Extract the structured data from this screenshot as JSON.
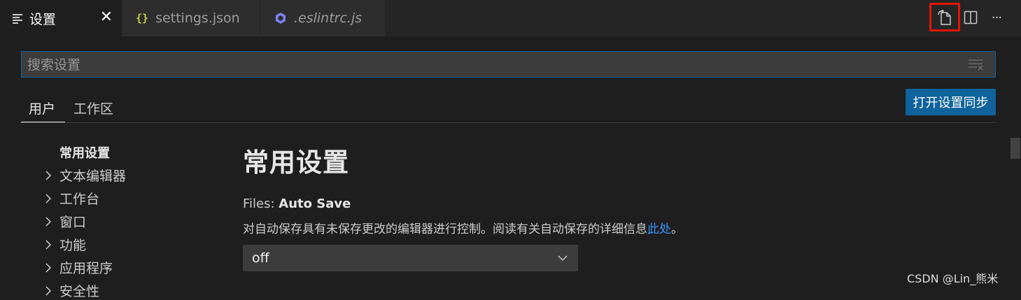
{
  "tabs": [
    {
      "label": "设置",
      "icon": "settings-editor-icon",
      "active": true,
      "close": "✕"
    },
    {
      "label": "settings.json",
      "icon": "json-braces-icon",
      "active": false
    },
    {
      "label": ".eslintrc.js",
      "icon": "eslint-icon",
      "active": false,
      "italic": true
    }
  ],
  "editor_actions": {
    "open_json_icon": "open-settings-json-icon",
    "split_icon": "split-editor-icon",
    "more": "···"
  },
  "search": {
    "placeholder": "搜索设置",
    "value": ""
  },
  "scope_tabs": {
    "user": "用户",
    "workspace": "工作区"
  },
  "sync_button": "打开设置同步",
  "toc": {
    "title": "常用设置",
    "items": [
      "文本编辑器",
      "工作台",
      "窗口",
      "功能",
      "应用程序",
      "安全性"
    ]
  },
  "main": {
    "heading": "常用设置",
    "setting": {
      "category": "Files: ",
      "name": "Auto Save",
      "description_prefix": "对自动保存具有未保存更改的编辑器进行控制。阅读有关自动保存的详细信息",
      "link_text": "此处",
      "description_suffix": "。",
      "value": "off"
    }
  },
  "watermark": "CSDN @Lin_熊米",
  "colors": {
    "accent": "#0e639c",
    "highlight": "#e51400",
    "link": "#3794ff",
    "json_icon": "#cbcb41",
    "eslint_icon": "#8080f2"
  }
}
